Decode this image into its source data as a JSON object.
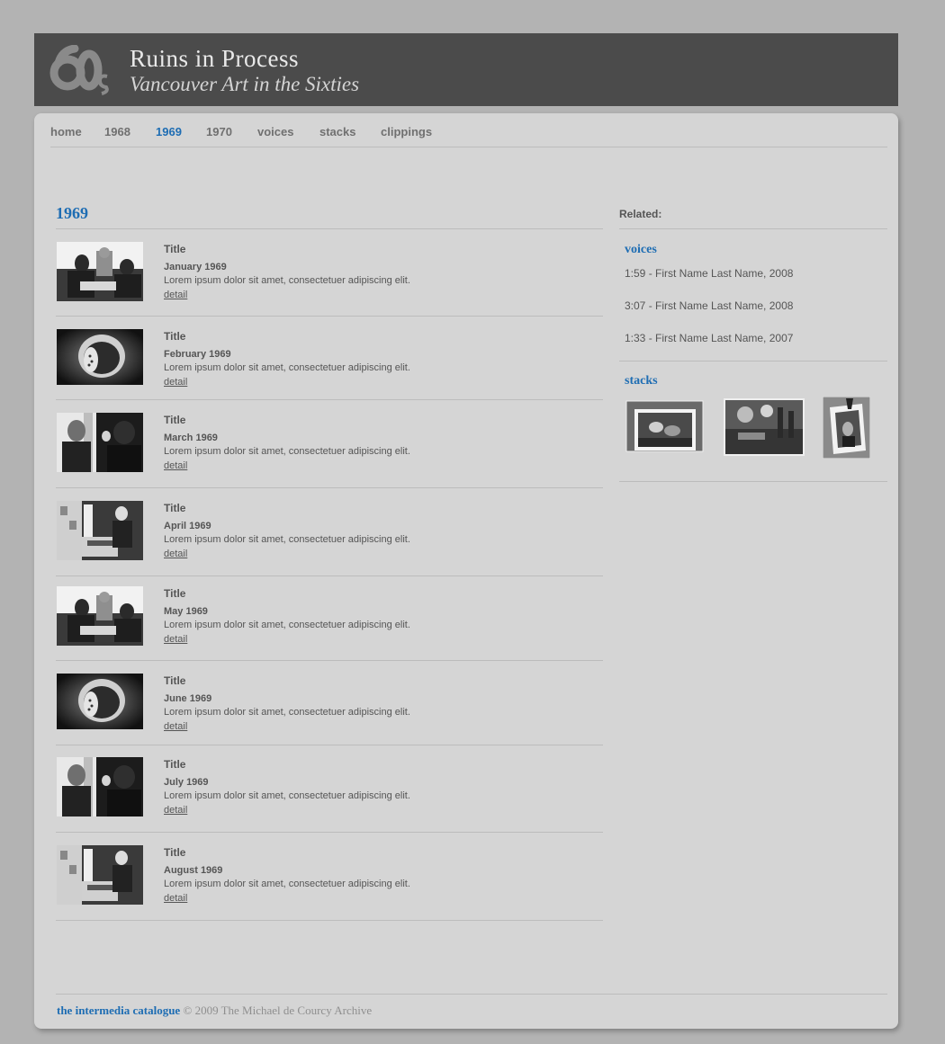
{
  "header": {
    "logo_text": "60s",
    "title": "Ruins in Process",
    "subtitle": "Vancouver Art in the Sixties"
  },
  "nav": {
    "items": [
      {
        "label": "home"
      },
      {
        "label": "1968"
      },
      {
        "label": "1969"
      },
      {
        "label": "1970"
      },
      {
        "label": "voices"
      },
      {
        "label": "stacks"
      },
      {
        "label": "clippings"
      }
    ],
    "active": "1969"
  },
  "main": {
    "heading": "1969",
    "entries": [
      {
        "title": "Title",
        "date": "January 1969",
        "description": "Lorem ipsum dolor sit amet, consectetuer adipiscing elit.",
        "link": "detail",
        "photo": "two-men-reading-photo"
      },
      {
        "title": "Title",
        "date": "February 1969",
        "description": "Lorem ipsum dolor sit amet, consectetuer adipiscing elit.",
        "link": "detail",
        "photo": "oval-sculpture-photo"
      },
      {
        "title": "Title",
        "date": "March 1969",
        "description": "Lorem ipsum dolor sit amet, consectetuer adipiscing elit.",
        "link": "detail",
        "photo": "two-people-drinking-photo"
      },
      {
        "title": "Title",
        "date": "April 1969",
        "description": "Lorem ipsum dolor sit amet, consectetuer adipiscing elit.",
        "link": "detail",
        "photo": "studio-printing-photo"
      },
      {
        "title": "Title",
        "date": "May 1969",
        "description": "Lorem ipsum dolor sit amet, consectetuer adipiscing elit.",
        "link": "detail",
        "photo": "two-men-reading-photo"
      },
      {
        "title": "Title",
        "date": "June 1969",
        "description": "Lorem ipsum dolor sit amet, consectetuer adipiscing elit.",
        "link": "detail",
        "photo": "oval-sculpture-photo"
      },
      {
        "title": "Title",
        "date": "July 1969",
        "description": "Lorem ipsum dolor sit amet, consectetuer adipiscing elit.",
        "link": "detail",
        "photo": "two-people-drinking-photo"
      },
      {
        "title": "Title",
        "date": "August 1969",
        "description": "Lorem ipsum dolor sit amet, consectetuer adipiscing elit.",
        "link": "detail",
        "photo": "studio-printing-photo"
      }
    ]
  },
  "sidebar": {
    "related_label": "Related:",
    "voices_heading": "voices",
    "voices": [
      {
        "label": "1:59 - First Name Last Name, 2008"
      },
      {
        "label": "3:07 - First Name Last Name, 2008"
      },
      {
        "label": "1:33 - First Name Last Name, 2007"
      }
    ],
    "stacks_heading": "stacks",
    "stacks": [
      {
        "photo": "stacked-photos-people-sitting"
      },
      {
        "photo": "outdoor-group-photo"
      },
      {
        "photo": "pinned-portrait-photo"
      }
    ]
  },
  "footer": {
    "link": "the intermedia catalogue",
    "copyright": "© 2009 The Michael de Courcy Archive"
  },
  "colors": {
    "page_bg": "#b3b3b3",
    "banner_bg": "#4b4b4b",
    "panel_bg": "#d5d5d5",
    "accent": "#1e6db3",
    "text": "#555555"
  }
}
